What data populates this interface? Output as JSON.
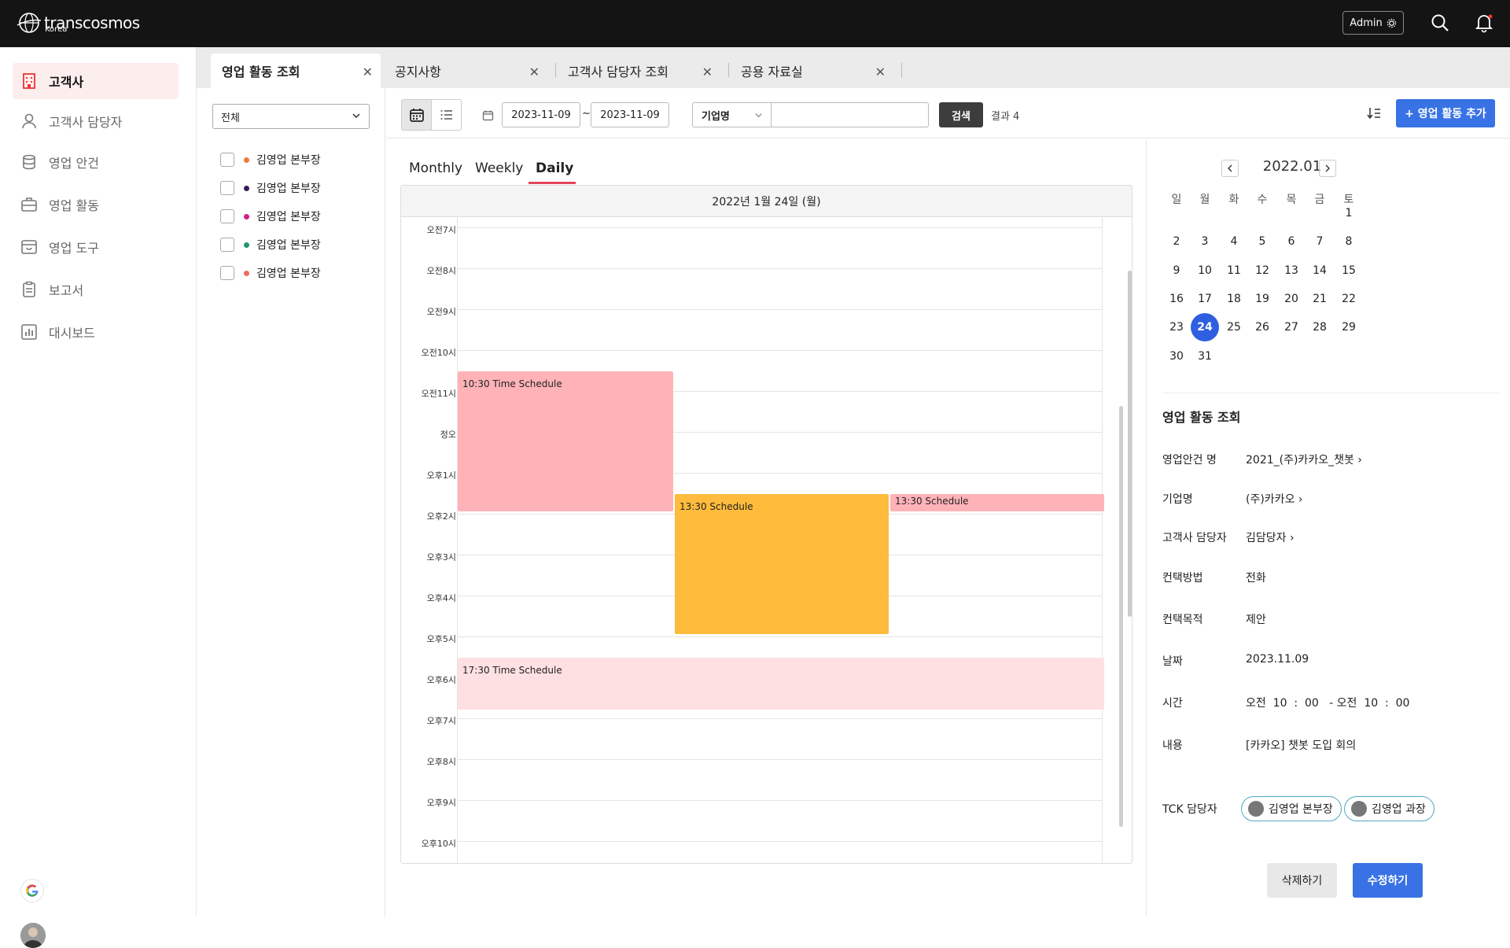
{
  "header": {
    "brand": "transcosmos",
    "brand_sub": "Korea",
    "admin_label": "Admin"
  },
  "sidebar": {
    "items": [
      {
        "label": "고객사",
        "icon": "building-icon"
      },
      {
        "label": "고객사 담당자",
        "icon": "person-icon"
      },
      {
        "label": "영업 안건",
        "icon": "database-icon"
      },
      {
        "label": "영업 활동",
        "icon": "briefcase-icon"
      },
      {
        "label": "영업 도구",
        "icon": "box-icon"
      },
      {
        "label": "보고서",
        "icon": "clipboard-icon"
      },
      {
        "label": "대시보드",
        "icon": "chart-icon"
      }
    ]
  },
  "tabs": [
    {
      "label": "영업 활동 조회"
    },
    {
      "label": "공지사항"
    },
    {
      "label": "고객사 담당자 조회"
    },
    {
      "label": "공용 자료실"
    }
  ],
  "filter": {
    "select_value": "전체",
    "people": [
      {
        "name": "김영업 본부장",
        "color": "#f07a3a"
      },
      {
        "name": "김영업 본부장",
        "color": "#3a1a5a"
      },
      {
        "name": "김영업 본부장",
        "color": "#d61e8a"
      },
      {
        "name": "김영업 본부장",
        "color": "#1e9a6a"
      },
      {
        "name": "김영업 본부장",
        "color": "#f06a60"
      }
    ]
  },
  "toolbar": {
    "date_from": "2023-11-09",
    "date_sep": "~",
    "date_to": "2023-11-09",
    "field_select": "기업명",
    "search_value": "",
    "search_label": "검색",
    "result_text": "결과 4",
    "add_label": "+ 영업 활동 추가"
  },
  "view_tabs": {
    "monthly": "Monthly",
    "weekly": "Weekly",
    "daily": "Daily"
  },
  "calendar": {
    "date_title": "2022년 1월 24일 (월)",
    "hours": [
      "오전7시",
      "오전8시",
      "오전9시",
      "오전10시",
      "오전11시",
      "정오",
      "오후1시",
      "오후2시",
      "오후3시",
      "오후4시",
      "오후5시",
      "오후6시",
      "오후7시",
      "오후8시",
      "오후9시",
      "오후10시"
    ],
    "events": [
      {
        "label": "10:30 Time Schedule",
        "color": "#ffb3b8"
      },
      {
        "label": "13:30 Schedule",
        "color": "#ffbb3b"
      },
      {
        "label": "13:30 Schedule",
        "color": "#ffb3b8"
      },
      {
        "label": "17:30 Time Schedule",
        "color": "#ffe0e2"
      }
    ]
  },
  "mini_calendar": {
    "title": "2022.01",
    "weekdays": [
      "일",
      "월",
      "화",
      "수",
      "목",
      "금",
      "토"
    ],
    "selected_day": "24"
  },
  "detail": {
    "title": "영업 활동 조회",
    "fields": [
      {
        "label": "영업안건 명",
        "value": "2021_(주)카카오_챗봇 ›"
      },
      {
        "label": "기업명",
        "value": "(주)카카오 ›"
      },
      {
        "label": "고객사 담당자",
        "value": "김담당자 ›"
      },
      {
        "label": "컨택방법",
        "value": "전화"
      },
      {
        "label": "컨택목적",
        "value": "제안"
      },
      {
        "label": "날짜",
        "value": "2023.11.09"
      },
      {
        "label": "시간",
        "value": "오전  10  :  00   - 오전  10  :  00"
      },
      {
        "label": "내용",
        "value": "[카카오] 챗봇 도입 회의"
      }
    ],
    "tck_label": "TCK 담당자",
    "tck_people": [
      "김영업 본부장",
      "김영업 과장"
    ],
    "delete_label": "삭제하기",
    "save_label": "수정하기"
  }
}
